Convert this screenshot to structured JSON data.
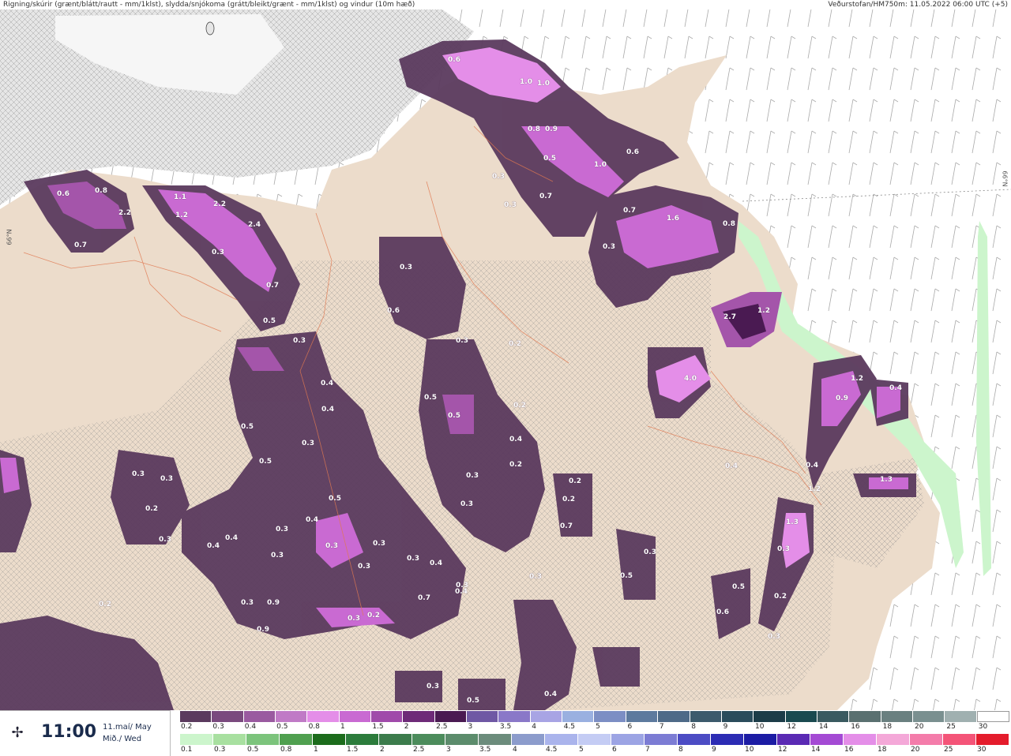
{
  "header": {
    "left": "Rigning/skúrir (grænt/blátt/rautt - mm/1klst), slydda/snjókoma (grátt/bleikt/grænt - mm/1klst) og vindur (10m hæð)",
    "right": "Veðurstofan/HM750m: 11.05.2022 06:00 UTC (+5)"
  },
  "latitude_labels": [
    "66°N",
    "66°N"
  ],
  "time_box": {
    "time": "11:00",
    "date_line1": "11.maí/ May",
    "date_line2": "Mið./ Wed",
    "icon": "weather-station-icon"
  },
  "legend": {
    "top_row": {
      "labels": [
        "0.2",
        "0.3",
        "0.4",
        "0.5",
        "0.8",
        "1",
        "1.5",
        "2",
        "2.5",
        "3",
        "3.5",
        "4",
        "4.5",
        "5",
        "6",
        "7",
        "8",
        "9",
        "10",
        "12",
        "14",
        "16",
        "18",
        "20",
        "25",
        "30"
      ],
      "colors": [
        "#5b3a5e",
        "#7a4a7e",
        "#9a5aa0",
        "#c07ac6",
        "#e48ee8",
        "#c96ad2",
        "#a04aaa",
        "#6e2a78",
        "#4a1a52",
        "#6f58a4",
        "#8a78c8",
        "#a8a4e4",
        "#9ab0e0",
        "#7c8ec4",
        "#5d7a9e",
        "#4e6a88",
        "#3c5a6c",
        "#2a4c5c",
        "#1c3c48",
        "#1a4a50",
        "#3a5a60",
        "#5a7070",
        "#6a8080",
        "#7a9090",
        "#a0b0b0",
        "#ffffff"
      ]
    },
    "bottom_row": {
      "labels": [
        "0.1",
        "0.3",
        "0.5",
        "0.8",
        "1",
        "1.5",
        "2",
        "2.5",
        "3",
        "3.5",
        "4",
        "4.5",
        "5",
        "6",
        "7",
        "8",
        "9",
        "10",
        "12",
        "14",
        "16",
        "18",
        "20",
        "25",
        "30"
      ],
      "colors": [
        "#ccf5cc",
        "#a8e0a0",
        "#7cc47c",
        "#50a050",
        "#1c6c1c",
        "#2c7c3c",
        "#3c7c4c",
        "#4c8c5c",
        "#5c8c6c",
        "#6c8c7c",
        "#8c9ccc",
        "#aab4ec",
        "#c4ccf4",
        "#9ca4e4",
        "#7c7cd4",
        "#4c4cc4",
        "#2c2cb4",
        "#1c1ca4",
        "#5a2ab4",
        "#a44ad4",
        "#e48ee8",
        "#f4a8d8",
        "#f47caa",
        "#f45478",
        "#e41c2c"
      ]
    }
  },
  "map": {
    "colors": {
      "land": "#ecdccb",
      "ice": "#e6e6e6",
      "sea": "#ffffff",
      "precip_low": "#5b3a5e",
      "precip_mid": "#a455aa",
      "precip_high": "#e48ee8",
      "rain_green": "#ccf5cc",
      "roads": "#e07850"
    },
    "values": [
      "0.6",
      "1.0",
      "1.0",
      "0.8",
      "0.9",
      "0.6",
      "1.0",
      "0.5",
      "0.3",
      "0.7",
      "0.3",
      "1.6",
      "0.7",
      "0.3",
      "0.8",
      "0.6",
      "0.8",
      "2.2",
      "1.1",
      "1.2",
      "2.2",
      "2.4",
      "0.7",
      "0.3",
      "0.7",
      "0.5",
      "0.4",
      "0.4",
      "0.3",
      "0.3",
      "0.5",
      "0.5",
      "0.3",
      "0.3",
      "0.2",
      "0.3",
      "0.4",
      "0.4",
      "0.3",
      "0.3",
      "0.4",
      "0.5",
      "0.3",
      "0.3",
      "0.3",
      "0.3",
      "0.4",
      "0.4",
      "0.7",
      "0.3",
      "0.2",
      "0.3",
      "0.9",
      "0.9",
      "4.0",
      "2.7",
      "1.2",
      "1.2",
      "0.9",
      "0.4",
      "0.4",
      "1.2",
      "1.3",
      "1.3",
      "0.3",
      "0.4",
      "0.6",
      "0.5",
      "0.2",
      "0.3",
      "0.5",
      "0.5",
      "0.6",
      "0.3",
      "0.2",
      "0.2",
      "0.3",
      "0.4",
      "0.3",
      "0.3",
      "0.2",
      "0.2",
      "0.2",
      "0.7",
      "0.3",
      "0.3",
      "0.5",
      "0.3",
      "0.4",
      "0.5",
      "0.3",
      "0.2"
    ]
  }
}
